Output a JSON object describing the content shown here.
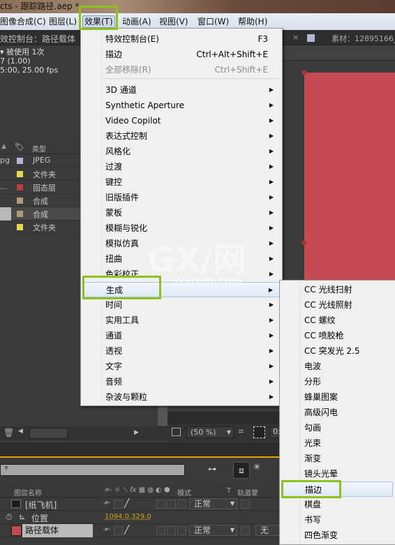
{
  "window": {
    "title": "cts - 跟踪路径.aep *"
  },
  "menubar": {
    "items": [
      "图像合成(C)",
      "图层(L)",
      "效果(T)",
      "动画(A)",
      "视图(V)",
      "窗口(W)",
      "帮助(H)"
    ]
  },
  "effect_controls": {
    "tab": "效控制台：路径载体",
    "usage": "被使用 1次",
    "line2": "7 (1.00)",
    "line3": "5:00, 25.00 fps"
  },
  "project": {
    "type_header": "类型",
    "rows": [
      {
        "name": "pg",
        "type": "JPEG",
        "color": "#b4b4d6"
      },
      {
        "name": "",
        "type": "文件夹",
        "color": "#e6d84a"
      },
      {
        "name": "...",
        "type": "固态层",
        "color": "#c03a3a"
      },
      {
        "name": "",
        "type": "合成",
        "color": "#b09a78"
      },
      {
        "name": "",
        "type": "合成",
        "color": "#b09a78"
      },
      {
        "name": "",
        "type": "文件夹",
        "color": "#e6d84a"
      }
    ]
  },
  "composition": {
    "tab": "素材：12895166_",
    "zoom": "(50 %)",
    "solid_color": "#c64a52",
    "time": "0:"
  },
  "effect_menu": {
    "top": [
      {
        "label": "特效控制台(E)",
        "shortcut": "F3"
      },
      {
        "label": "描边",
        "shortcut": "Ctrl+Alt+Shift+E"
      },
      {
        "label": "全部移除(R)",
        "shortcut": "Ctrl+Shift+E",
        "disabled": true
      }
    ],
    "categories": [
      "3D 通道",
      "Synthetic Aperture",
      "Video Copilot",
      "表达式控制",
      "风格化",
      "过渡",
      "键控",
      "旧版插件",
      "蒙板",
      "模糊与锐化",
      "模拟仿真",
      "扭曲",
      "色彩校正",
      "生成",
      "时间",
      "实用工具",
      "通道",
      "透视",
      "文字",
      "音频",
      "杂波与颗粒"
    ],
    "highlighted": "生成"
  },
  "generate_submenu": {
    "items": [
      "CC 光线扫射",
      "CC 光线照射",
      "CC 螺纹",
      "CC 喷胶枪",
      "CC 突发光 2.5",
      "电波",
      "分形",
      "蜂巢图案",
      "高级闪电",
      "勾画",
      "光束",
      "渐变",
      "镜头光晕",
      "描边",
      "棋盘",
      "书写",
      "四色渐变"
    ],
    "highlighted": "描边"
  },
  "timeline": {
    "headers": {
      "layer_name": "图层名称",
      "mode": "模式",
      "t": "T",
      "track_matte": "轨道蒙"
    },
    "layers": [
      {
        "name": "[纸飞机]",
        "mode": "正常"
      },
      {
        "name": "位置",
        "value": "1094.0,329.0"
      },
      {
        "name": "路径载体",
        "mode": "正常",
        "matte": "无",
        "color": "#c64a52"
      }
    ]
  },
  "watermark": {
    "text": "GX/网",
    "sub": "system.com"
  },
  "colors": {
    "highlight_box": "#8cc21a",
    "accent_line": "#e8a000"
  }
}
